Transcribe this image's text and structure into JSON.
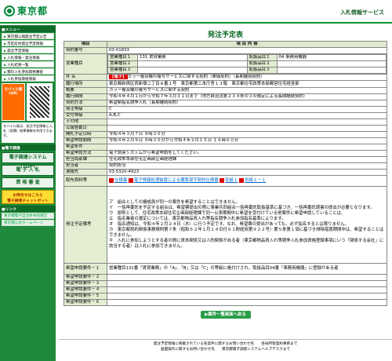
{
  "header": {
    "logo": "東京都",
    "service": "入札情報サービス"
  },
  "sidebar": {
    "menu_head": "■メニュー",
    "items": [
      "東京都公報発注予定公告",
      "市区町村発注予定情報",
      "発注予定情報",
      "入札情報・発注情報",
      "入札結果一覧",
      "都の入札参加資格審査",
      "入札参加資格情報"
    ],
    "mobile_label": "モバイル版",
    "mobile_sub": "(QR)",
    "mobile_text": "モバイル版は、発注予定情報と入札（見積）結果情報を利用できます。",
    "etc_head": "■電子調達",
    "buttons": [
      "電子調達システム(TOP)",
      "電 子 入 札",
      "資 格 審 査"
    ],
    "help": "お問合せはこちら",
    "help_sub": "電子調達チャットボット",
    "links_head": "■リンク",
    "links": [
      "東京都電子自治体共同運営",
      "東京都公式ホームページ"
    ]
  },
  "page": {
    "title": "発注予定表"
  },
  "table": {
    "col_item": "項目",
    "col_content": "項 目 内 容",
    "rows": [
      {
        "label": "契約番号",
        "value": "03-01833"
      },
      {
        "label": "件 名",
        "badge": "【電子】",
        "value": "カラー複合機の複写サービスに関する契約（単価契約）（長期継続契約）"
      },
      {
        "label": "履行場所",
        "value": "東京都新宿区西新宿二丁目８番１号　東京都第二本庁舎１３階　東京都住宅政策本部都営住宅経営部"
      },
      {
        "label": "概要",
        "value": "カラー複合機の複写サービスに関する契約"
      },
      {
        "label": "履行期間",
        "value": "令和４年４月１日から令和７年３月３１日まで（地方自治法第２３４条の３の規定による長期継続契約）"
      },
      {
        "label": "契約方法",
        "value": "希望制指名競争入札（長期継続契約）"
      },
      {
        "label": "発注等級",
        "value": "C"
      },
      {
        "label": "受付等級",
        "value": "A,B,C"
      },
      {
        "label": "その他",
        "value": ""
      },
      {
        "label": "公報登載日",
        "value": ""
      },
      {
        "label": "開札予定日時",
        "value": "令和４年３月７日 ９時３０分"
      },
      {
        "label": "希望申請期間",
        "value": "令和４年２月９日 ９時３０分から令和４年２月１５日 １６時００分"
      },
      {
        "label": "希望条件",
        "value": ""
      },
      {
        "label": "希望申請方法",
        "value": "電子調達システムから希望申請をしてください。"
      },
      {
        "label": "担当局部課",
        "value": "住宅政策本部住宅企画部企画経理課"
      },
      {
        "label": "担当者",
        "value": "契約担当"
      },
      {
        "label": "連絡先",
        "value": "03-5320-4923"
      }
    ],
    "business": {
      "label": "営業種目",
      "items": [
        {
          "k": "営業種目１",
          "v": "131 賃貸業務",
          "k2": "取扱品目１",
          "v2": "04 事務用機器"
        },
        {
          "k": "営業種目２",
          "v": "",
          "k2": "取扱品目２",
          "v2": ""
        },
        {
          "k": "営業種目３",
          "v": "",
          "k2": "取扱品目３",
          "v2": ""
        }
      ]
    },
    "docs": {
      "label": "配布資料等",
      "files": [
        "仕様書",
        "電子情報処理装置による標準保守契約仕様書",
        "別紙１",
        "別紙１－１"
      ]
    },
    "notes": {
      "label": "発注予定備考",
      "lines": [
        "ア　組合としての構成員が同一の案件を希望することはできません。",
        "イ　一括再委託を予定する組合は、希望票提出の際に事業共同組合一括再委託取扱基準に基づき、一括再委託調書の提出が必要となります。",
        "ウ　原則として、住宅政策本部住宅企画部経理課で同一公表期間中に希望を受付けている他案件に希望申請していることは、",
        "エ　指名業者の選定については、東京都物品買入れ等指名競争入札参加指名基準によります。",
        "オ　指名通知は、令和４年２月２４日（木）に行う予定です。なお、希望票の提出があっても、必ず指名するとは限りません。",
        "カ　東京都契約関係事務規則第７条（昭和６２年１月１４日付６１財経庶第９２２号）第５条第１項に基づき排除措置期間中は、希望することはできません。",
        "キ　入札に参加しようとする者の間に資本関係又は人的関係がある者（東京都物品買入れ等競争入札参加資格登録事項にいう「関係する会社」に該当する者）は入札に参加できません。"
      ]
    },
    "conds": [
      {
        "label": "希望申請要件－１",
        "value": "営業種目131番「賃貸業務」の「A」、「B」又は「C」の等級に格付けされ、取扱品目04番「事務用機器」に登録がある者"
      },
      {
        "label": "希望申請要件－２",
        "value": ""
      },
      {
        "label": "希望申請要件－３",
        "value": ""
      },
      {
        "label": "希望申請要件－４",
        "value": ""
      },
      {
        "label": "希望申請要件－５",
        "value": ""
      },
      {
        "label": "希望申請要件－６",
        "value": ""
      }
    ]
  },
  "back_button": "▶案件一覧画面へ戻る",
  "footer": {
    "line1": "発注予定情報に掲載されている各案件に関するお問い合わせ先　　各局所管契約事務まで",
    "line2": "画面操作に関するお問い合わせ先　　東京都電子調達システムヘルプデスクまで"
  }
}
